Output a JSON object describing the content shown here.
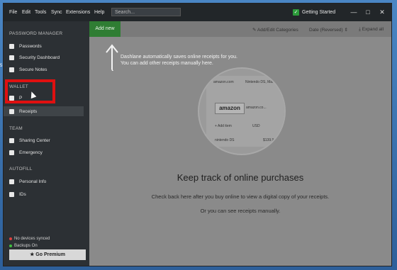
{
  "desktop": {
    "edge_text": "5"
  },
  "titlebar": {
    "menu": [
      "File",
      "Edit",
      "Tools",
      "Sync",
      "Extensions",
      "Help"
    ],
    "search_placeholder": "Search...",
    "getting_started": "Getting Started",
    "controls": [
      "—",
      "□",
      "✕"
    ]
  },
  "sidebar": {
    "section_password_manager": "PASSWORD MANAGER",
    "passwords": "Passwords",
    "security_dashboard": "Security Dashboard",
    "secure_notes": "Secure Notes",
    "section_wallet": "WALLET",
    "wallet_item": "P",
    "receipts": "Receipts",
    "section_team": "TEAM",
    "sharing_center": "Sharing Center",
    "emergency": "Emergency",
    "section_autofill": "AUTOFILL",
    "personal_info": "Personal Info",
    "ids": "IDs",
    "no_devices_synced": "No devices synced",
    "backups_on": "Backups On",
    "go_premium": "Go Premium",
    "colors": {
      "no_devices": "#e04040",
      "backups": "#40c040"
    }
  },
  "toolbar": {
    "add_new": "Add new",
    "add_edit_categories": "Add/Edit Categories",
    "sort": "Date (Reversed)",
    "expand_all": "Expand all"
  },
  "main": {
    "hint": "Dashlane automatically saves online receipts for you. You can add other receipts manually here.",
    "illustration": {
      "site1": "amazon.com",
      "site2": "Nintendo DS, Mario K...",
      "amazon_logo": "amazon",
      "amazon_label": "amazon.co...",
      "add_item": "+ Add item",
      "currency": "USD",
      "row_left": "nintendo DS",
      "row_right": "$139.9"
    },
    "heading": "Keep track of online purchases",
    "line1": "Check back here after you buy online to view a digital copy of your receipts.",
    "line2": "Or you can see receipts manually."
  }
}
